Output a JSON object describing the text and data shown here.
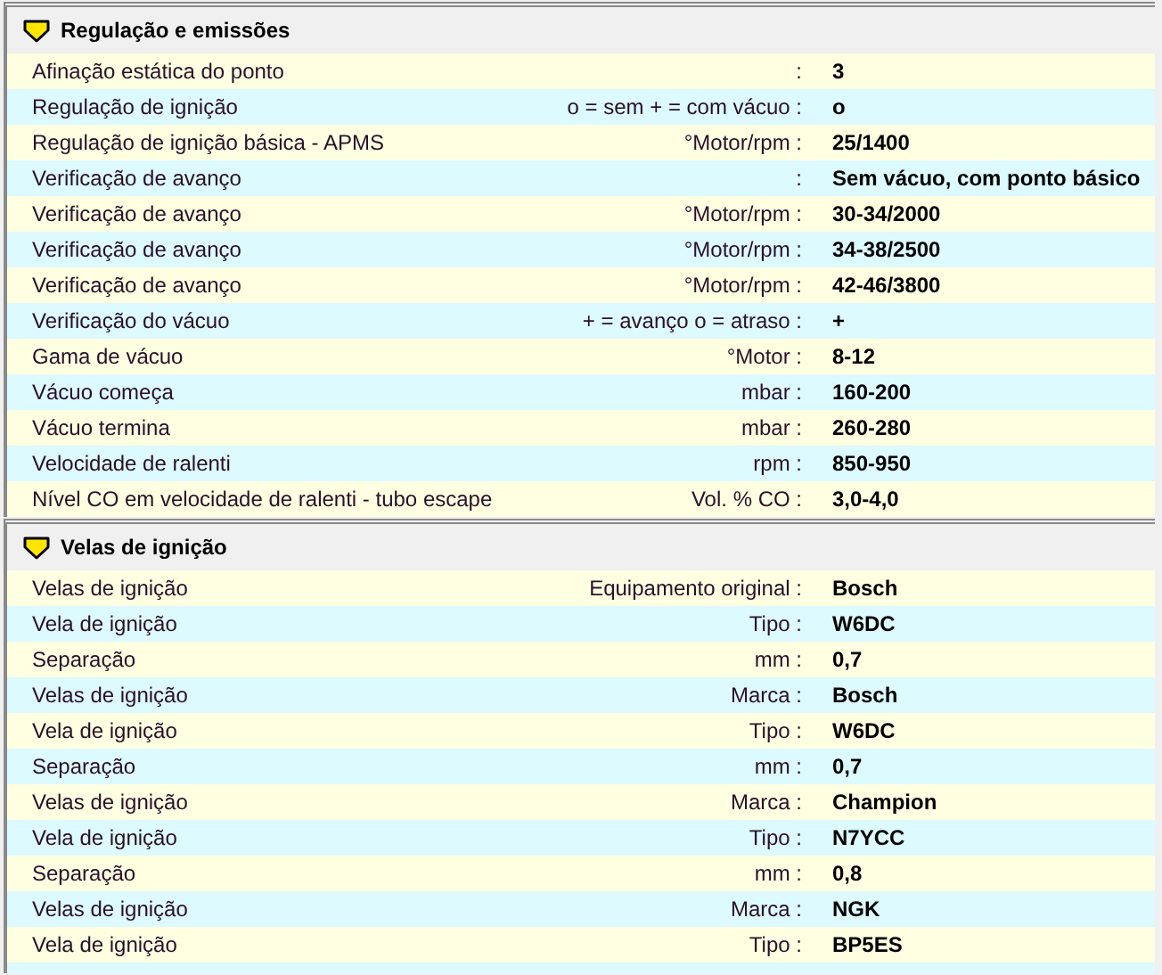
{
  "sections": [
    {
      "title": "Regulação e emissões",
      "rows": [
        {
          "label": "Afinação estática do ponto",
          "unit": ":",
          "value": "3"
        },
        {
          "label": "Regulação de ignição",
          "unit": "o = sem  + = com vácuo :",
          "value": "o"
        },
        {
          "label": "Regulação de ignição básica  - APMS",
          "unit": "°Motor/rpm :",
          "value": "25/1400"
        },
        {
          "label": "Verificação de avanço",
          "unit": ":",
          "value": "Sem vácuo, com ponto básico"
        },
        {
          "label": "Verificação de avanço",
          "unit": "°Motor/rpm :",
          "value": "30-34/2000"
        },
        {
          "label": "Verificação de avanço",
          "unit": "°Motor/rpm :",
          "value": "34-38/2500"
        },
        {
          "label": "Verificação de avanço",
          "unit": "°Motor/rpm :",
          "value": "42-46/3800"
        },
        {
          "label": "Verificação do vácuo",
          "unit": "+ = avanço  o = atraso :",
          "value": "+"
        },
        {
          "label": "Gama de vácuo",
          "unit": "°Motor :",
          "value": "8-12"
        },
        {
          "label": "Vácuo começa",
          "unit": "mbar :",
          "value": "160-200"
        },
        {
          "label": "Vácuo termina",
          "unit": "mbar :",
          "value": "260-280"
        },
        {
          "label": "Velocidade de ralenti",
          "unit": "rpm :",
          "value": "850-950"
        },
        {
          "label": "Nível CO em velocidade de ralenti - tubo escape",
          "unit": "Vol. % CO :",
          "value": "3,0-4,0"
        }
      ]
    },
    {
      "title": "Velas de ignição",
      "rows": [
        {
          "label": "Velas de ignição",
          "unit": "Equipamento original :",
          "value": "Bosch"
        },
        {
          "label": "Vela de ignição",
          "unit": "Tipo :",
          "value": "W6DC"
        },
        {
          "label": "Separação",
          "unit": "mm :",
          "value": "0,7"
        },
        {
          "label": "Velas de ignição",
          "unit": "Marca :",
          "value": "Bosch"
        },
        {
          "label": "Vela de ignição",
          "unit": "Tipo :",
          "value": "W6DC"
        },
        {
          "label": "Separação",
          "unit": "mm :",
          "value": "0,7"
        },
        {
          "label": "Velas de ignição",
          "unit": "Marca :",
          "value": "Champion"
        },
        {
          "label": "Vela de ignição",
          "unit": "Tipo :",
          "value": "N7YCC"
        },
        {
          "label": "Separação",
          "unit": "mm :",
          "value": "0,8"
        },
        {
          "label": "Velas de ignição",
          "unit": "Marca :",
          "value": "NGK"
        },
        {
          "label": "Vela de ignição",
          "unit": "Tipo :",
          "value": "BP5ES"
        }
      ]
    }
  ]
}
